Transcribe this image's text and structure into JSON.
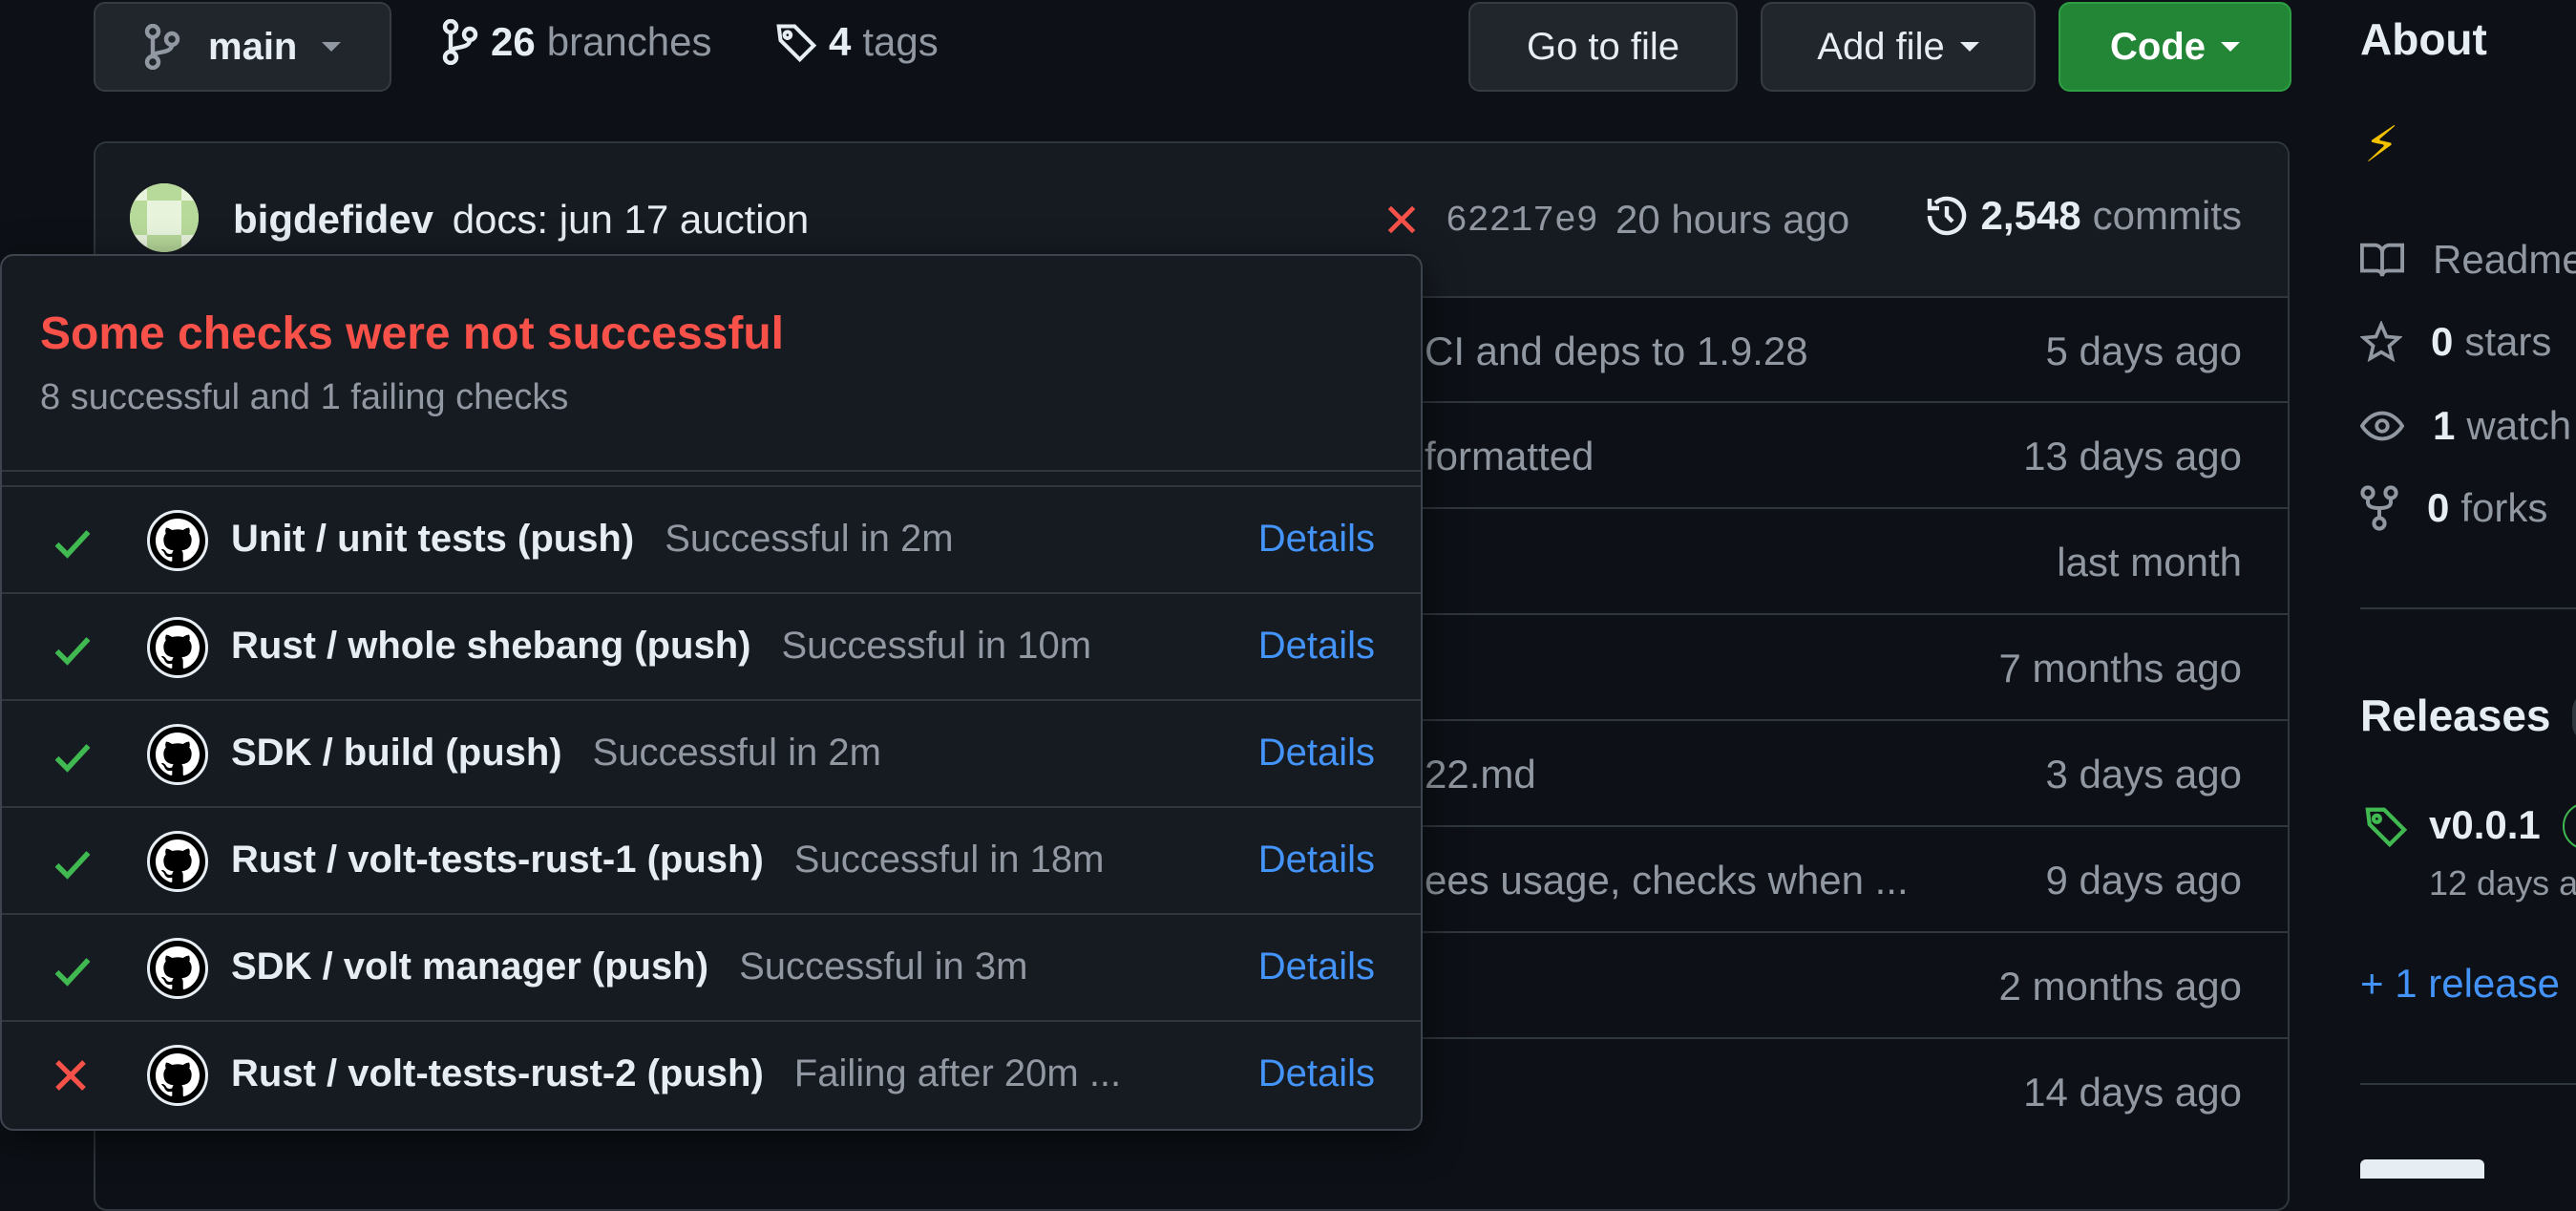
{
  "toolbar": {
    "branch": "main",
    "branches_count": "26",
    "branches_label": "branches",
    "tags_count": "4",
    "tags_label": "tags",
    "go_to_file": "Go to file",
    "add_file": "Add file",
    "code": "Code"
  },
  "commit": {
    "author": "bigdefidev",
    "message": "docs: jun 17 auction",
    "sha": "62217e9",
    "time": "20 hours ago",
    "commits_count": "2,548",
    "commits_label": "commits"
  },
  "files": [
    {
      "msg": "CI and deps to 1.9.28",
      "when": "5 days ago"
    },
    {
      "msg": "formatted",
      "when": "13 days ago"
    },
    {
      "msg": "",
      "when": "last month"
    },
    {
      "msg": "",
      "when": "7 months ago"
    },
    {
      "msg": "22.md",
      "when": "3 days ago"
    },
    {
      "msg": "ees usage, checks when ...",
      "when": "9 days ago"
    },
    {
      "msg": "",
      "when": "2 months ago"
    },
    {
      "msg": "",
      "when": "14 days ago"
    }
  ],
  "checks_popover": {
    "title": "Some checks were not successful",
    "subtitle": "8 successful and 1 failing checks",
    "items": [
      {
        "name": "Unit / unit tests (push)",
        "desc": "Successful in 2m",
        "status": "success",
        "details": "Details"
      },
      {
        "name": "Rust / whole shebang (push)",
        "desc": "Successful in 10m",
        "status": "success",
        "details": "Details"
      },
      {
        "name": "SDK / build (push)",
        "desc": "Successful in 2m",
        "status": "success",
        "details": "Details"
      },
      {
        "name": "Rust / volt-tests-rust-1 (push)",
        "desc": "Successful in 18m",
        "status": "success",
        "details": "Details"
      },
      {
        "name": "SDK / volt manager (push)",
        "desc": "Successful in 3m",
        "status": "success",
        "details": "Details"
      },
      {
        "name": "Rust / volt-tests-rust-2 (push)",
        "desc": "Failing after 20m ...",
        "status": "failure",
        "details": "Details"
      }
    ]
  },
  "sidebar": {
    "about": "About",
    "about_emoji": "⚡",
    "readme": "Readme",
    "stars_count": "0",
    "stars_label": "stars",
    "watch_count": "1",
    "watch_label": "watch",
    "forks_count": "0",
    "forks_label": "forks",
    "releases": "Releases",
    "release_tag": "v0.0.1",
    "release_date": "12 days a",
    "more_releases": "+ 1 release"
  },
  "colors": {
    "background": "#0d1117",
    "success": "#3fb950",
    "failure": "#f85149",
    "link": "#4493f8",
    "code_button": "#238636"
  }
}
